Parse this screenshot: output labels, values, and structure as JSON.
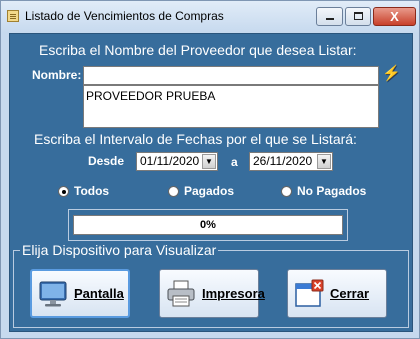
{
  "window": {
    "title": "Listado de Vencimientos de Compras",
    "close_glyph": "X"
  },
  "provider": {
    "heading": "Escriba el Nombre del Proveedor que desea Listar:",
    "label": "Nombre:",
    "value": "",
    "results": [
      "PROVEEDOR PRUEBA"
    ],
    "search_icon": "lightning-icon",
    "search_glyph": "⚡"
  },
  "dates": {
    "heading": "Escriba el Intervalo de Fechas por el que se Listará:",
    "from_label": "Desde",
    "from_value": "01/11/2020",
    "to_label": "a",
    "to_value": "26/11/2020",
    "dropdown_glyph": "▼"
  },
  "filter": {
    "options": [
      "Todos",
      "Pagados",
      "No Pagados"
    ],
    "selected": "Todos"
  },
  "progress": {
    "label": "0%",
    "value": 0
  },
  "device": {
    "legend": "Elija Dispositivo para Visualizar",
    "pantalla_label": "Pantalla",
    "impresora_label": "Impresora",
    "cerrar_label": "Cerrar"
  },
  "colors": {
    "panel": "#376d9c",
    "accent": "#5a9be0"
  }
}
